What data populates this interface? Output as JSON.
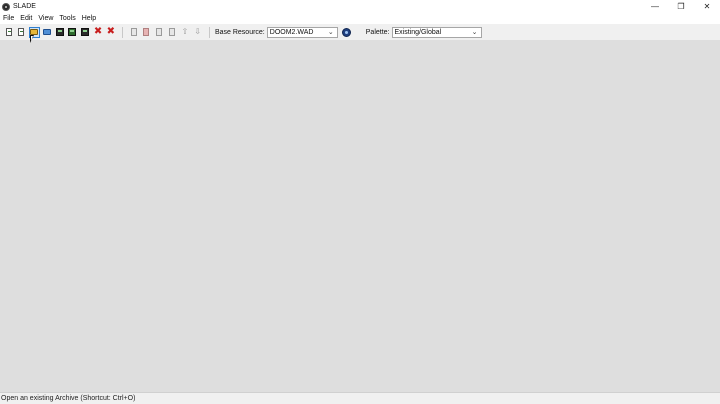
{
  "window": {
    "title": "SLADE"
  },
  "window_controls": {
    "minimize": "—",
    "restore": "❐",
    "close": "✕"
  },
  "menu": {
    "items": [
      "File",
      "Edit",
      "View",
      "Tools",
      "Help"
    ]
  },
  "toolbar": {
    "base_resource_label": "Base Resource:",
    "base_resource_value": "DOOM2.WAD",
    "palette_label": "Palette:",
    "palette_value": "Existing/Global",
    "chevron": "⌄",
    "x_glyph": "✖",
    "arrow_up": "⇧",
    "arrow_down": "⇩"
  },
  "status": {
    "text": "Open an existing Archive (Shortcut: Ctrl+O)"
  }
}
